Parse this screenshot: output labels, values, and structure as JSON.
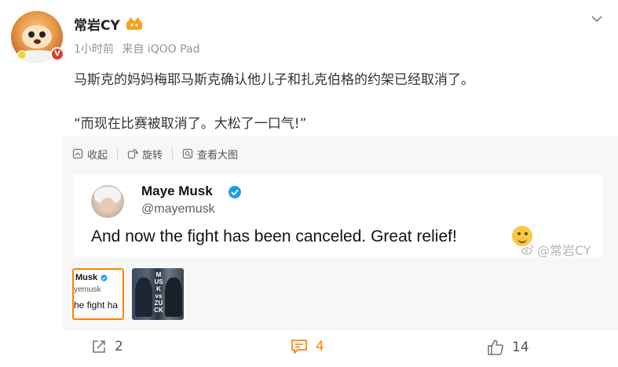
{
  "post": {
    "author": "常岩CY",
    "time": "1小时前",
    "source": "来自 iQOO Pad",
    "text": "马斯克的妈妈梅耶马斯克确认他儿子和扎克伯格的约架已经取消了。",
    "quote": "“而现在比赛被取消了。大松了一口气!”"
  },
  "toolbar": {
    "collapse_label": "收起",
    "rotate_label": "旋转",
    "view_large_label": "查看大图"
  },
  "tweet": {
    "name": "Maye Musk",
    "handle": "@mayemusk",
    "text": "And now the fight has been canceled. Great relief!",
    "watermark": "@常岩CY"
  },
  "thumbnails": {
    "t1_name": "Musk",
    "t1_handle": "yemusk",
    "t1_text": "he fight ha",
    "t2_text": "MUSK vs ZUCK"
  },
  "actions": {
    "share_count": "2",
    "comment_count": "4",
    "like_count": "14"
  },
  "colors": {
    "accent": "#ff8200",
    "verified_blue": "#1d9bf0",
    "meta_gray": "#939393"
  }
}
